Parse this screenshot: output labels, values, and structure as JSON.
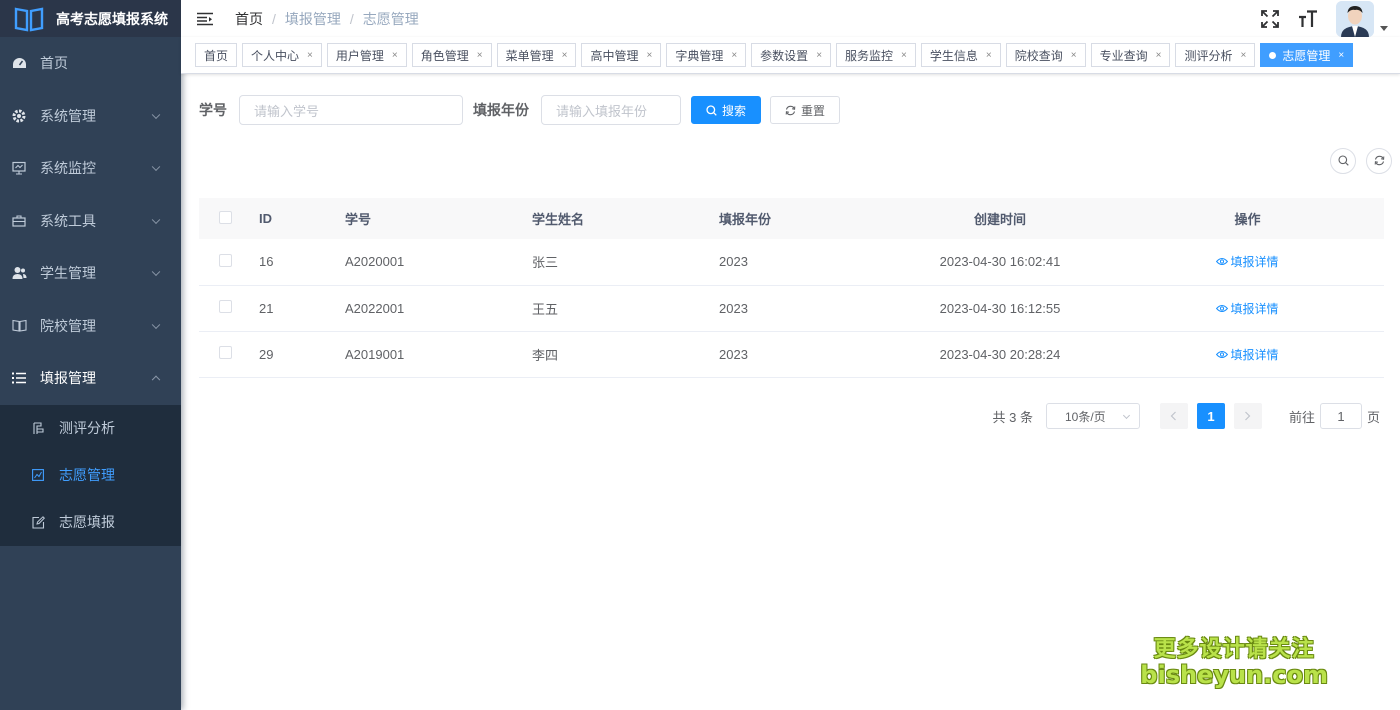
{
  "app": {
    "title": "高考志愿填报系统"
  },
  "sidebar": {
    "items": [
      {
        "label": "首页",
        "icon": "dashboard-icon"
      },
      {
        "label": "系统管理",
        "icon": "gear-icon"
      },
      {
        "label": "系统监控",
        "icon": "monitor-icon"
      },
      {
        "label": "系统工具",
        "icon": "toolbox-icon"
      },
      {
        "label": "学生管理",
        "icon": "user-icon"
      },
      {
        "label": "院校管理",
        "icon": "book-icon"
      },
      {
        "label": "填报管理",
        "icon": "list-icon"
      }
    ],
    "submenu": [
      {
        "label": "测评分析",
        "icon": "chart-icon"
      },
      {
        "label": "志愿管理",
        "icon": "image-icon"
      },
      {
        "label": "志愿填报",
        "icon": "edit-icon"
      }
    ]
  },
  "breadcrumb": [
    "首页",
    "填报管理",
    "志愿管理"
  ],
  "tags": [
    "首页",
    "个人中心",
    "用户管理",
    "角色管理",
    "菜单管理",
    "高中管理",
    "字典管理",
    "参数设置",
    "服务监控",
    "学生信息",
    "院校查询",
    "专业查询",
    "测评分析",
    "志愿管理"
  ],
  "tag_close": "×",
  "search": {
    "student_no_label": "学号",
    "student_no_placeholder": "请输入学号",
    "year_label": "填报年份",
    "year_placeholder": "请输入填报年份",
    "search_btn": "搜索",
    "reset_btn": "重置"
  },
  "table": {
    "headers": [
      "ID",
      "学号",
      "学生姓名",
      "填报年份",
      "创建时间",
      "操作"
    ],
    "rows": [
      {
        "id": "16",
        "no": "A2020001",
        "name": "张三",
        "year": "2023",
        "time": "2023-04-30 16:02:41",
        "op": "填报详情"
      },
      {
        "id": "21",
        "no": "A2022001",
        "name": "王五",
        "year": "2023",
        "time": "2023-04-30 16:12:55",
        "op": "填报详情"
      },
      {
        "id": "29",
        "no": "A2019001",
        "name": "李四",
        "year": "2023",
        "time": "2023-04-30 20:28:24",
        "op": "填报详情"
      }
    ]
  },
  "pagination": {
    "total": "共 3 条",
    "page_size": "10条/页",
    "current": "1",
    "goto_label": "前往",
    "goto_value": "1",
    "page_suffix": "页"
  },
  "watermark": {
    "line1": "更多设计请关注",
    "line2": "bisheyun.com"
  },
  "colors": {
    "sidebar_bg": "#304156",
    "accent": "#1890ff",
    "active_tag": "#409eff"
  }
}
